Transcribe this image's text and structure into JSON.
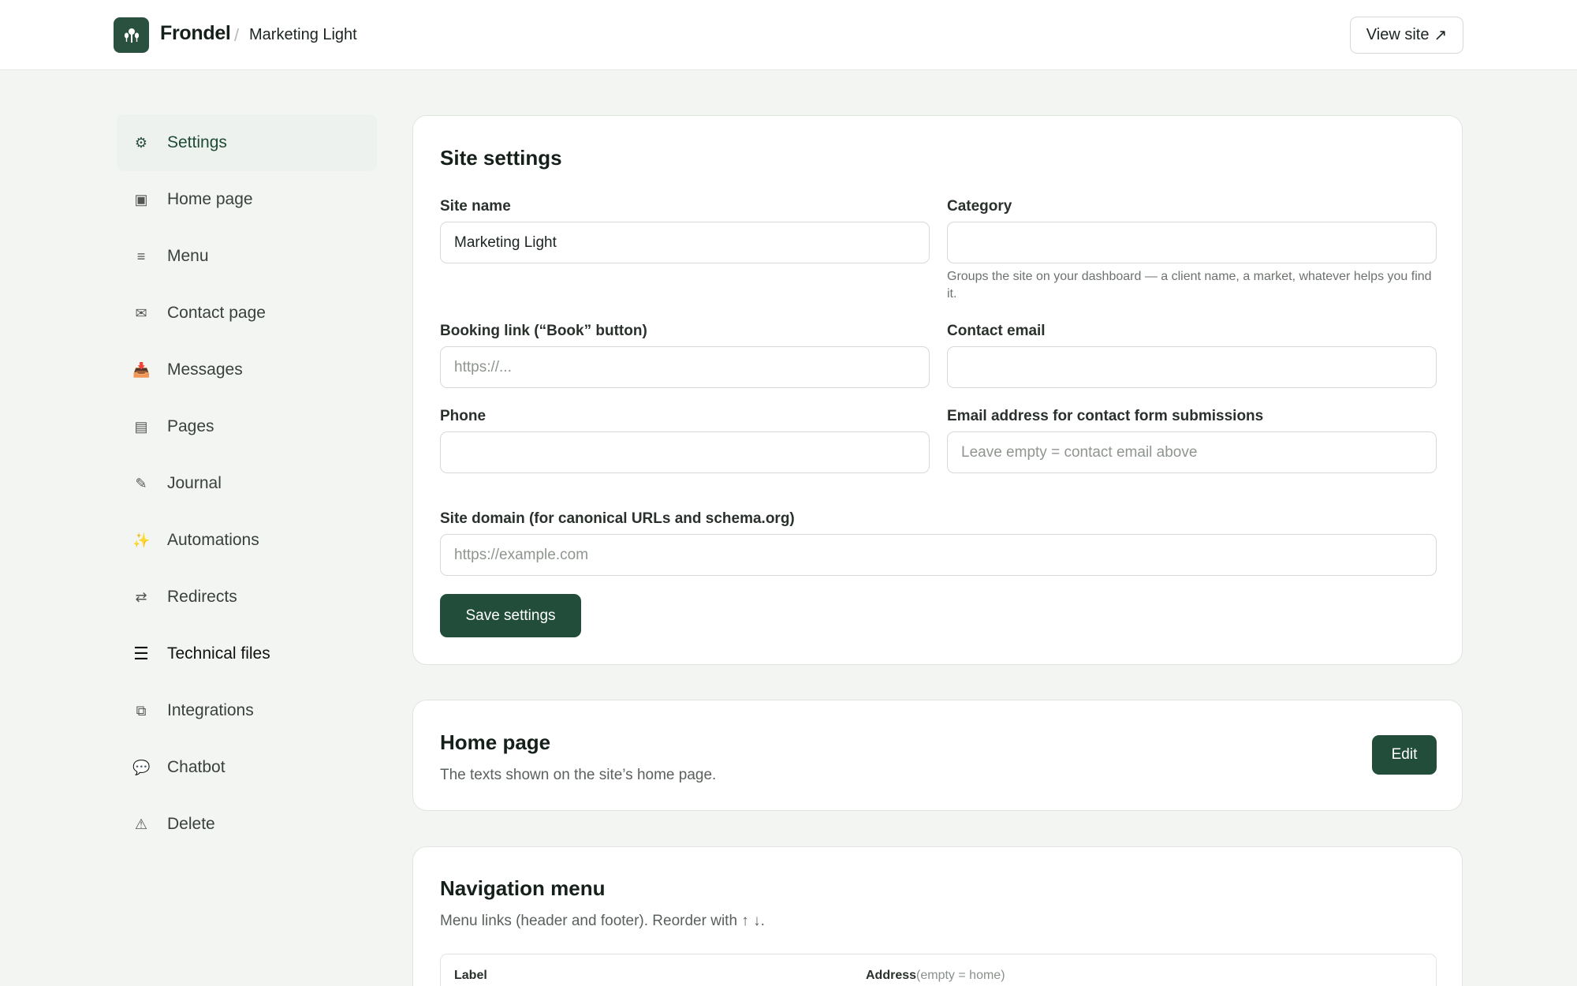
{
  "header": {
    "brand": "Frondel",
    "separator": "/",
    "site_name": "Marketing Light",
    "view_site_label": "View site",
    "view_site_icon": "↗"
  },
  "sidebar": {
    "items": [
      {
        "label": "Settings",
        "icon": "gear-icon",
        "glyph": "⚙"
      },
      {
        "label": "Home page",
        "icon": "home-page-icon",
        "glyph": "▣"
      },
      {
        "label": "Menu",
        "icon": "menu-icon",
        "glyph": "≡"
      },
      {
        "label": "Contact page",
        "icon": "envelope-icon",
        "glyph": "✉"
      },
      {
        "label": "Messages",
        "icon": "inbox-icon",
        "glyph": "📥"
      },
      {
        "label": "Pages",
        "icon": "pages-icon",
        "glyph": "▤"
      },
      {
        "label": "Journal",
        "icon": "pencil-icon",
        "glyph": "✎"
      },
      {
        "label": "Automations",
        "icon": "sparkles-icon",
        "glyph": "✨"
      },
      {
        "label": "Redirects",
        "icon": "redirect-arrows-icon",
        "glyph": "⇄"
      },
      {
        "label": "Technical files",
        "icon": "file-lines-icon",
        "glyph": "☰"
      },
      {
        "label": "Integrations",
        "icon": "integrations-icon",
        "glyph": "⧉"
      },
      {
        "label": "Chatbot",
        "icon": "chat-bubble-icon",
        "glyph": "💬"
      },
      {
        "label": "Delete",
        "icon": "warning-icon",
        "glyph": "⚠"
      }
    ]
  },
  "site_settings": {
    "title": "Site settings",
    "site_name_label": "Site name",
    "site_name_value": "Marketing Light",
    "category_label": "Category",
    "category_value": "",
    "category_hint": "Groups the site on your dashboard — a client name, a market, whatever helps you find it.",
    "booking_label": "Booking link (“Book” button)",
    "booking_placeholder": "https://...",
    "contact_email_label": "Contact email",
    "contact_email_value": "",
    "phone_label": "Phone",
    "phone_value": "",
    "submissions_email_label": "Email address for contact form submissions",
    "submissions_email_placeholder": "Leave empty = contact email above",
    "domain_label": "Site domain (for canonical URLs and schema.org)",
    "domain_placeholder": "https://example.com",
    "save_label": "Save settings"
  },
  "home_page": {
    "title": "Home page",
    "subtitle": "The texts shown on the site’s home page.",
    "edit_label": "Edit"
  },
  "navigation_menu": {
    "title": "Navigation menu",
    "subtitle": "Menu links (header and footer). Reorder with ↑ ↓.",
    "col_label": "Label",
    "col_address": "Address",
    "col_address_note": "(empty = home)"
  }
}
